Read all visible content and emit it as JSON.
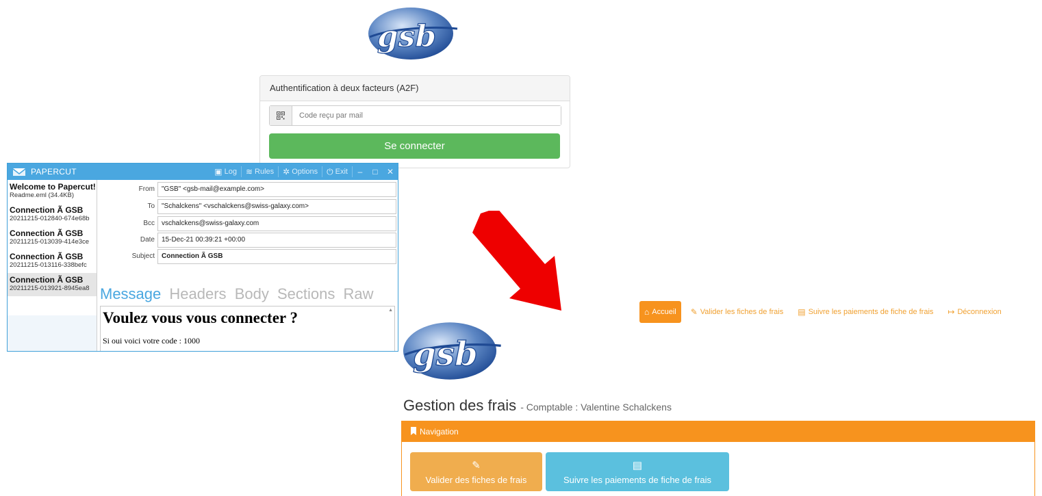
{
  "logo": {
    "text": "gsb"
  },
  "login": {
    "title": "Authentification à deux facteurs (A2F)",
    "code_icon": "qr-code-icon",
    "code_placeholder": "Code reçu par mail",
    "submit_label": "Se connecter",
    "submit_color": "#5cb85c"
  },
  "papercut": {
    "title": "PAPERCUT",
    "accent": "#4aa7e0",
    "toolbar": [
      {
        "icon": "log-icon",
        "label": "Log"
      },
      {
        "icon": "rules-icon",
        "label": "Rules"
      },
      {
        "icon": "gear-icon",
        "label": "Options"
      },
      {
        "icon": "power-icon",
        "label": "Exit"
      }
    ],
    "messages": [
      {
        "title": "Welcome to Papercut!",
        "sub": "Readme.eml (34.4KB)"
      },
      {
        "title": "Connection Ã  GSB",
        "sub": "20211215-012840-674e68b"
      },
      {
        "title": "Connection Ã  GSB",
        "sub": "20211215-013039-414e3ce"
      },
      {
        "title": "Connection Ã  GSB",
        "sub": "20211215-013116-338befc"
      },
      {
        "title": "Connection Ã  GSB",
        "sub": "20211215-013921-8945ea8"
      }
    ],
    "fields": {
      "from_label": "From",
      "from_value": "\"GSB\" <gsb-mail@example.com>",
      "to_label": "To",
      "to_value": "\"Schalckens\" <vschalckens@swiss-galaxy.com>",
      "bcc_label": "Bcc",
      "bcc_value": "vschalckens@swiss-galaxy.com",
      "date_label": "Date",
      "date_value": "15-Dec-21 00:39:21 +00:00",
      "subject_label": "Subject",
      "subject_value": "Connection Ã  GSB"
    },
    "tabs": [
      "Message",
      "Headers",
      "Body",
      "Sections",
      "Raw"
    ],
    "active_tab": "Message",
    "body": {
      "heading": "Voulez vous vous connecter ?",
      "text": "Si oui voici votre code : 1000"
    }
  },
  "app": {
    "accent": "#f7931e",
    "nav": [
      {
        "icon": "home-icon",
        "label": "Accueil",
        "active": true
      },
      {
        "icon": "pencil-icon",
        "label": "Valider les fiches de frais"
      },
      {
        "icon": "list-icon",
        "label": "Suivre les paiements de fiche de frais"
      },
      {
        "icon": "logout-icon",
        "label": "Déconnexion"
      }
    ],
    "page_title": "Gestion des frais",
    "page_subtitle": "- Comptable : Valentine Schalckens",
    "panel_title": "Navigation",
    "panel_icon": "bookmark-icon",
    "tiles": [
      {
        "icon": "pencil-icon",
        "label": "Valider des fiches de frais",
        "color": "#f0ad4e"
      },
      {
        "icon": "list-icon",
        "label": "Suivre les paiements de fiche de frais",
        "color": "#5bc0de"
      }
    ]
  }
}
